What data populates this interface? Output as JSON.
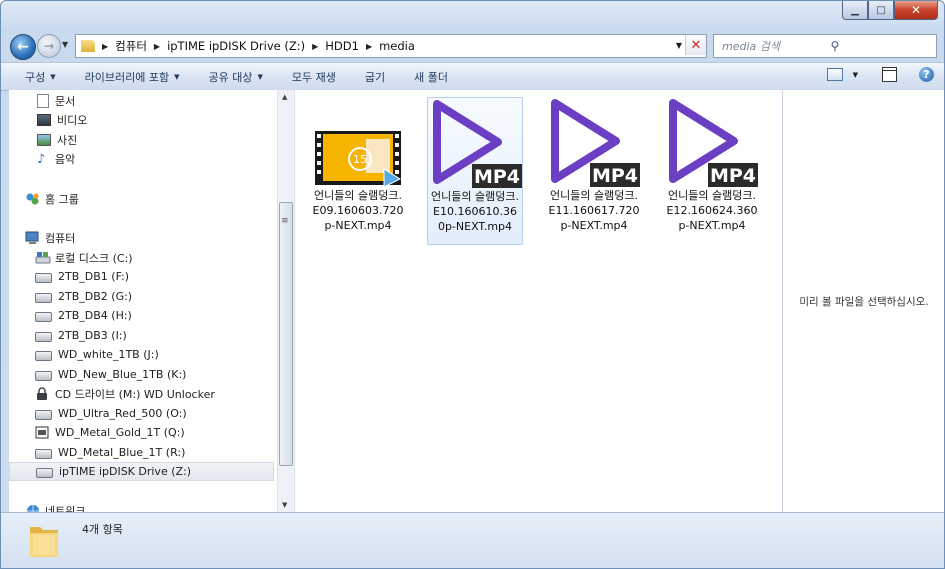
{
  "window": {
    "minimize": "▁",
    "maximize": "□",
    "close": "✕"
  },
  "address": {
    "crumbs": [
      "컴퓨터",
      "ipTIME ipDISK Drive (Z:)",
      "HDD1",
      "media"
    ]
  },
  "search": {
    "placeholder": "media 검색"
  },
  "toolbar": {
    "organize": "구성",
    "include_library": "라이브러리에 포함",
    "share": "공유 대상",
    "play_all": "모두 재생",
    "burn": "굽기",
    "new_folder": "새 폴더"
  },
  "nav": {
    "libraries": [
      "문서",
      "비디오",
      "사진",
      "음악"
    ],
    "homegroup": "홈 그룹",
    "computer": "컴퓨터",
    "drives": [
      "로컬 디스크 (C:)",
      "2TB_DB1 (F:)",
      "2TB_DB2 (G:)",
      "2TB_DB4 (H:)",
      "2TB_DB3 (I:)",
      "WD_white_1TB (J:)",
      "WD_New_Blue_1TB (K:)",
      "CD 드라이브 (M:) WD Unlocker",
      "WD_Ultra_Red_500 (O:)",
      "WD_Metal_Gold_1T (Q:)",
      "WD_Metal_Blue_1T (R:)",
      "ipTIME ipDISK Drive (Z:)"
    ],
    "network": "네트워크"
  },
  "files": [
    {
      "name": "언니들의 슬램덩크.E09.160603.720p-NEXT.mp4",
      "thumb": "video-thumbnail",
      "selected": false
    },
    {
      "name": "언니들의 슬램덩크.E10.160610.360p-NEXT.mp4",
      "thumb": "mp4-play-icon",
      "selected": true
    },
    {
      "name": "언니들의 슬램덩크.E11.160617.720p-NEXT.mp4",
      "thumb": "mp4-play-icon",
      "selected": false
    },
    {
      "name": "언니들의 슬램덩크.E12.160624.360p-NEXT.mp4",
      "thumb": "mp4-play-icon",
      "selected": false
    }
  ],
  "mp4_badge": "MP4",
  "thumb_age_badge": "15",
  "preview": {
    "message": "미리 볼 파일을 선택하십시오."
  },
  "status": {
    "count": "4개 항목"
  },
  "colors": {
    "play_purple": "#6b3fc4",
    "badge_dark": "#2b2b2b",
    "video_orange": "#f4b400"
  }
}
